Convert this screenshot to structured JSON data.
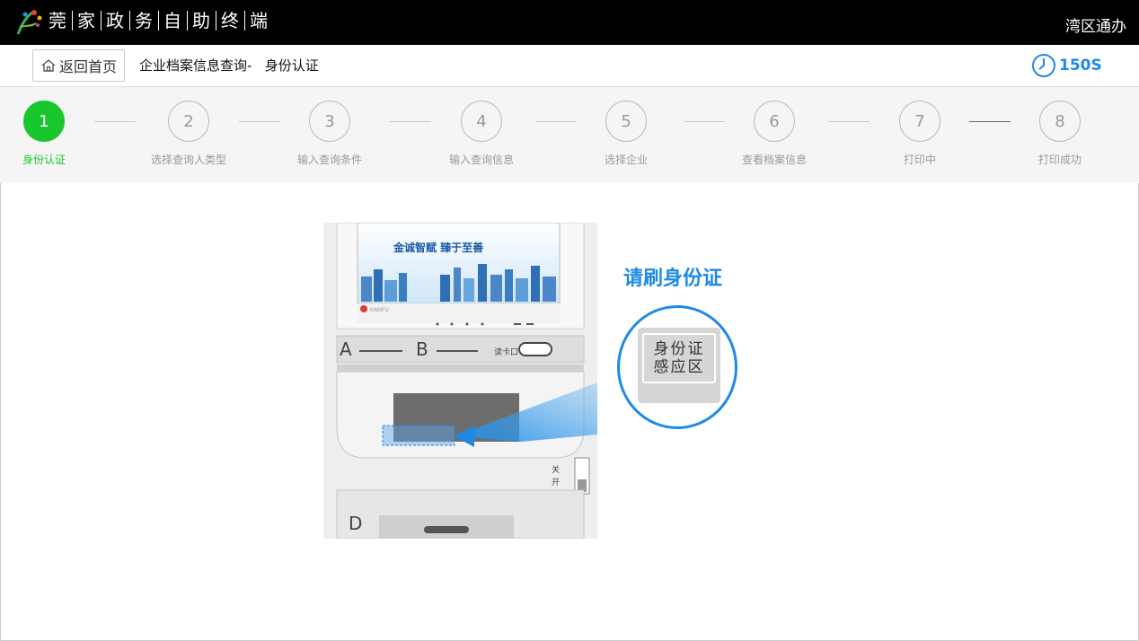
{
  "header": {
    "title_chars": [
      "莞",
      "家",
      "政",
      "务",
      "自",
      "助",
      "终",
      "端"
    ],
    "brand": "湾区通办"
  },
  "subbar": {
    "home_label": "返回首页",
    "breadcrumb": "企业档案信息查询-   身份认证",
    "countdown": "150S"
  },
  "steps": [
    {
      "num": "1",
      "label": "身份认证",
      "active": true
    },
    {
      "num": "2",
      "label": "选择查询人类型",
      "active": false
    },
    {
      "num": "3",
      "label": "输入查询条件",
      "active": false
    },
    {
      "num": "4",
      "label": "输入查询信息",
      "active": false
    },
    {
      "num": "5",
      "label": "选择企业",
      "active": false
    },
    {
      "num": "6",
      "label": "查看档案信息",
      "active": false
    },
    {
      "num": "7",
      "label": "打印中",
      "active": false
    },
    {
      "num": "8",
      "label": "打印成功",
      "active": false
    }
  ],
  "main": {
    "prompt": "请刷身份证",
    "zone_line1": "身份证",
    "zone_line2": "感应区",
    "kiosk": {
      "screen_banner": "金诚智赋 臻于至善",
      "brand_logo": "KAMFU",
      "slot_a": "A",
      "slot_b": "B",
      "slot_d": "D",
      "card_slot": "读卡口",
      "switch_close": "关",
      "switch_open": "开"
    }
  },
  "colors": {
    "accent_blue": "#1f8ae6",
    "active_green": "#19c62d",
    "topbar": "#000000"
  }
}
